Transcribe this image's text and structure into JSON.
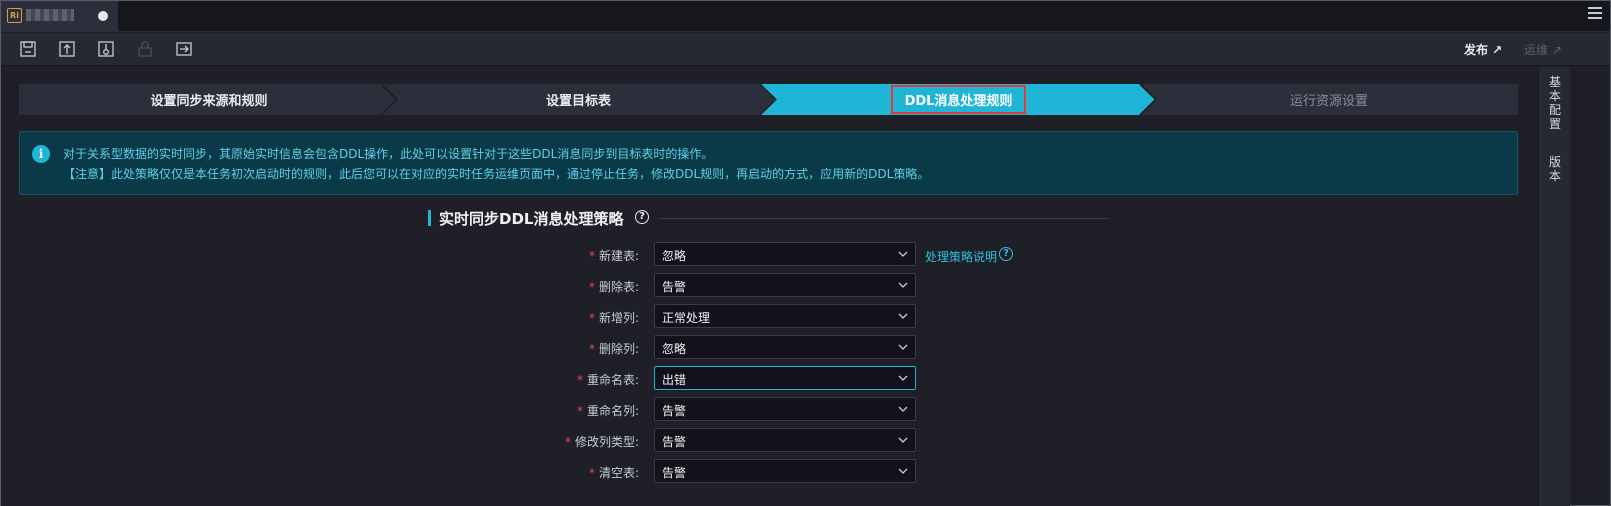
{
  "tab": {
    "app_icon_text": "Ri"
  },
  "toolbar": {
    "icons": [
      "save-icon",
      "submit-icon",
      "lock-file-icon",
      "unlock-icon",
      "export-icon"
    ],
    "publish_label": "发布 ↗",
    "ops_label": "运维 ↗"
  },
  "side": {
    "basic_config": "基本配置",
    "version": "版本"
  },
  "steps": [
    {
      "label": "设置同步来源和规则",
      "state": "done"
    },
    {
      "label": "设置目标表",
      "state": "done"
    },
    {
      "label": "DDL消息处理规则",
      "state": "active"
    },
    {
      "label": "运行资源设置",
      "state": "pending"
    }
  ],
  "info": {
    "icon": "i",
    "line1": "对于关系型数据的实时同步，其原始实时信息会包含DDL操作，此处可以设置针对于这些DDL消息同步到目标表时的操作。",
    "line2": "【注意】此处策略仅仅是本任务初次启动时的规则，此后您可以在对应的实时任务运维页面中，通过停止任务，修改DDL规则，再启动的方式，应用新的DDL策略。"
  },
  "section": {
    "title": "实时同步DDL消息处理策略",
    "help": "?"
  },
  "strategy_link": "处理策略说明",
  "link_help": "?",
  "required_mark": "*",
  "form": [
    {
      "label": "新建表:",
      "value": "忽略"
    },
    {
      "label": "删除表:",
      "value": "告警"
    },
    {
      "label": "新增列:",
      "value": "正常处理"
    },
    {
      "label": "删除列:",
      "value": "忽略"
    },
    {
      "label": "重命名表:",
      "value": "出错"
    },
    {
      "label": "重命名列:",
      "value": "告警"
    },
    {
      "label": "修改列类型:",
      "value": "告警"
    },
    {
      "label": "清空表:",
      "value": "告警"
    }
  ],
  "colors": {
    "accent": "#1fb5d6",
    "background": "#1e1f27",
    "step_bg": "#2c2e3b",
    "required": "#e0504a"
  }
}
